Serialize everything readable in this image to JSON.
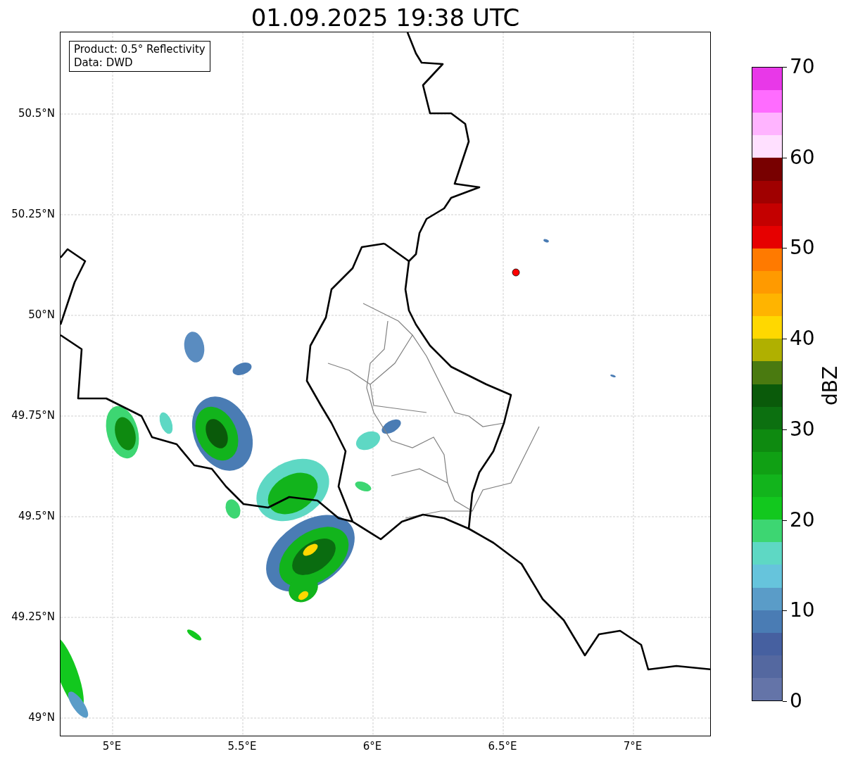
{
  "title": "01.09.2025 19:38 UTC",
  "info_box": [
    "Product: 0.5° Reflectivity",
    "Data: DWD"
  ],
  "lat_ticks": [
    "50.5°N",
    "50.25°N",
    "50°N",
    "49.75°N",
    "49.5°N",
    "49.25°N",
    "49°N"
  ],
  "lon_ticks": [
    "5°E",
    "5.5°E",
    "6°E",
    "6.5°E",
    "7°E"
  ],
  "colorbar": {
    "label": "dBZ",
    "ticks": [
      "70",
      "60",
      "50",
      "40",
      "30",
      "20",
      "10",
      "0"
    ],
    "segments": [
      {
        "color": "#e838e8"
      },
      {
        "color": "#ff6cff"
      },
      {
        "color": "#ffb4ff"
      },
      {
        "color": "#ffe0ff"
      },
      {
        "color": "#780000"
      },
      {
        "color": "#a00000"
      },
      {
        "color": "#c40000"
      },
      {
        "color": "#e60000"
      },
      {
        "color": "#ff7a00"
      },
      {
        "color": "#ff9a00"
      },
      {
        "color": "#ffb400"
      },
      {
        "color": "#ffd800"
      },
      {
        "color": "#b0b000"
      },
      {
        "color": "#4a7a10"
      },
      {
        "color": "#0a5a0a"
      },
      {
        "color": "#0c7010"
      },
      {
        "color": "#0e8a10"
      },
      {
        "color": "#10a014"
      },
      {
        "color": "#12b41c"
      },
      {
        "color": "#12c81e"
      },
      {
        "color": "#3dd672"
      },
      {
        "color": "#5ed8c4"
      },
      {
        "color": "#66c4dc"
      },
      {
        "color": "#5a9cc8"
      },
      {
        "color": "#4a7cb4"
      },
      {
        "color": "#4660a0"
      },
      {
        "color": "#5468a0"
      },
      {
        "color": "#6474a8"
      }
    ]
  }
}
